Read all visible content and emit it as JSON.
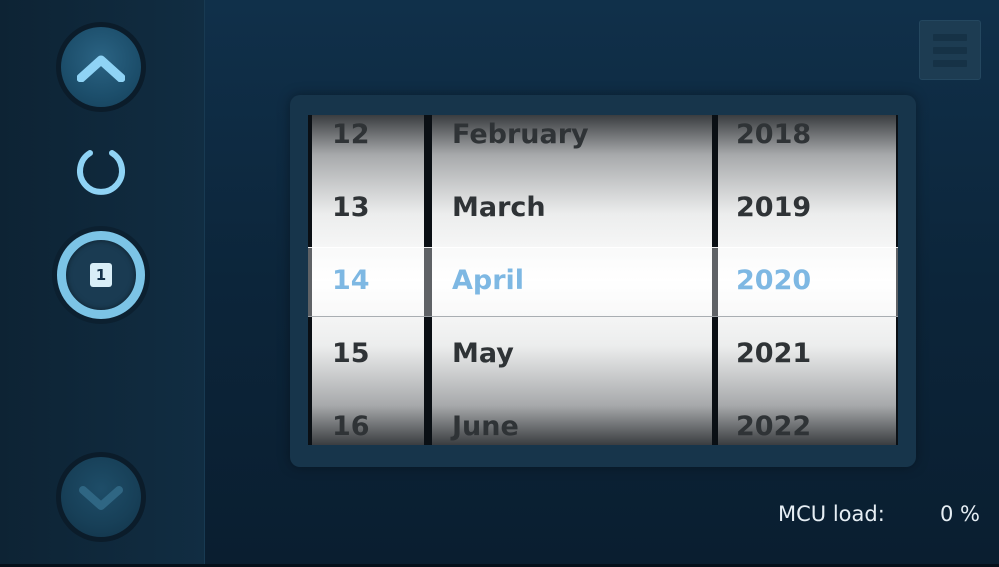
{
  "sidebar": {
    "up_button": {
      "icon": "chevron-up-icon"
    },
    "busy_indicator": {
      "icon": "loading-spinner-icon"
    },
    "page_badge": {
      "icon": "page-number-icon",
      "number": "1"
    },
    "down_button": {
      "icon": "chevron-down-icon"
    }
  },
  "menu_button": {
    "icon": "hamburger-menu-icon"
  },
  "date_picker": {
    "days": [
      "12",
      "13",
      "14",
      "15",
      "16"
    ],
    "months": [
      "February",
      "March",
      "April",
      "May",
      "June"
    ],
    "years": [
      "2018",
      "2019",
      "2020",
      "2021",
      "2022"
    ],
    "selected_index": 2,
    "selected": {
      "day": "14",
      "month": "April",
      "year": "2020"
    },
    "selected_color": "#3a93d4"
  },
  "status": {
    "label": "MCU load:",
    "value": "0 %"
  },
  "colors": {
    "accent": "#7cc4e6",
    "background": "#0c253a"
  }
}
